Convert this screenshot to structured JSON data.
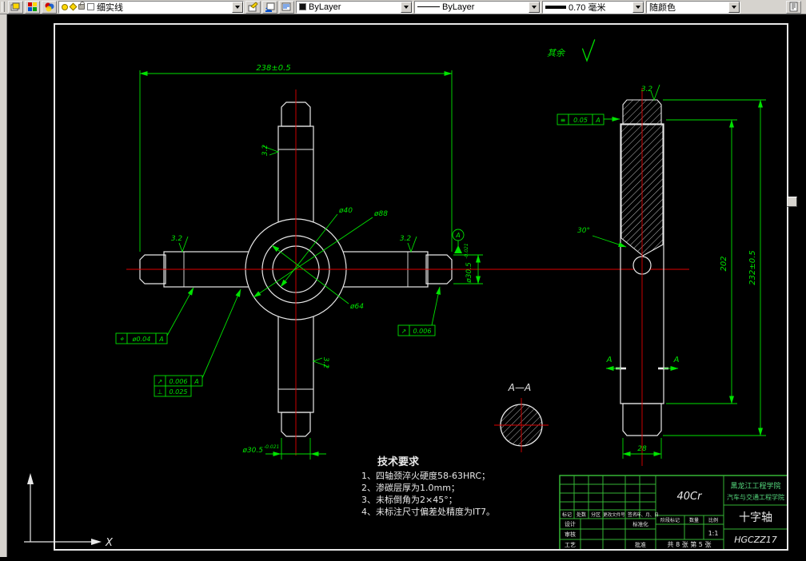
{
  "colors": {
    "outline": "#e8e8e8",
    "centerline": "#e00000",
    "dimension": "#00e200",
    "hatch": "#cfcfcf",
    "title_lines": "#35b535",
    "school_text": "#55d87d",
    "canvas_bg": "#000000",
    "toolbar_bg": "#d6d3ce"
  },
  "toolbar": {
    "layer_value": "细实线",
    "color_value": "ByLayer",
    "linetype_value": "ByLayer",
    "lineweight_value": "0.70 毫米",
    "plotstyle_value": "随颜色"
  },
  "drawing": {
    "dim_overall_width": "238±0.5",
    "dim_journal_dia": "ø30.5",
    "dim_journal_tol": "-0.021",
    "dim_journal_dia_bottom": "ø30.5",
    "dim_journal_tol_bottom": "-0.021",
    "dia_inner": "ø40",
    "dia_outer": "ø88",
    "dia_mid": "ø64",
    "roughness": "3.2",
    "rest_label": "其余",
    "angle_30": "30°",
    "dim_202": "202",
    "dim_overall_height": "232±0.5",
    "dim_28": "28",
    "section_title": "A—A",
    "section_mark": "A",
    "datum_label": "A",
    "gtol": {
      "position_sym": "⌖",
      "position_val": "ø0.04",
      "position_datum": "A",
      "runout_sym": "↗",
      "runout_val": "0.006",
      "runout_datum": "A",
      "perp_sym": "⊥",
      "perp_val": "0.025",
      "runout2_sym": "↗",
      "runout2_val": "0.006",
      "symmetry_sym": "≡",
      "symmetry_val": "0.05",
      "symmetry_datum": "A"
    },
    "tech": {
      "title": "技术要求",
      "item1": "1、四轴颈淬火硬度58-63HRC；",
      "item2": "2、渗碳层厚为1.0mm；",
      "item3": "3、未标倒角为2×45°；",
      "item4": "4、未标注尺寸偏差处精度为IT7。"
    },
    "ucs_x": "X"
  },
  "titleblock": {
    "material": "40Cr",
    "school1": "黑龙江工程学院",
    "school2": "汽车与交通工程学院",
    "part_name": "十字轴",
    "drawing_no": "HGCZZ17",
    "rev": {
      "h1": "标记",
      "h2": "处数",
      "h3": "分区",
      "h4": "更改文件号",
      "h5": "签名",
      "h6": "年、月、日"
    },
    "design": "设计",
    "check": "审核",
    "process": "工艺",
    "standardize": "标准化",
    "approve": "批准",
    "stage": "阶段标记",
    "qty": "数量",
    "scale_label": "比例",
    "scale": "1:1",
    "sheet": "共 8 张 第 5 张"
  }
}
